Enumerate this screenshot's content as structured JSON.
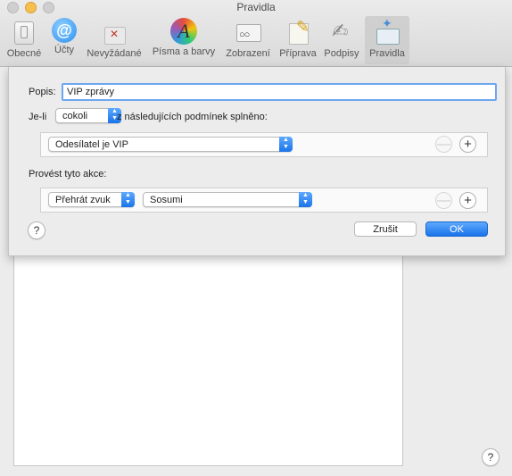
{
  "window": {
    "title": "Pravidla"
  },
  "toolbar": {
    "items": [
      {
        "label": "Obecné",
        "icon": "general-switch-icon"
      },
      {
        "label": "Účty",
        "icon": "at-sign-icon"
      },
      {
        "label": "Nevyžádané",
        "icon": "junk-trash-icon"
      },
      {
        "label": "Písma a barvy",
        "icon": "fonts-colors-icon"
      },
      {
        "label": "Zobrazení",
        "icon": "view-glasses-icon"
      },
      {
        "label": "Příprava",
        "icon": "compose-pencil-icon"
      },
      {
        "label": "Podpisy",
        "icon": "signature-icon"
      },
      {
        "label": "Pravidla",
        "icon": "rules-envelope-icon"
      }
    ],
    "active": "Pravidla"
  },
  "sheet": {
    "description_label": "Popis:",
    "description_value": "VIP zprávy",
    "if_label": "Je-li",
    "if_select": "cokoli",
    "if_suffix": "z následujících podmínek splněno:",
    "condition_select": "Odesílatel je VIP",
    "actions_label": "Provést tyto akce:",
    "action_select": "Přehrát zvuk",
    "sound_select": "Sosumi",
    "remove_symbol": "—",
    "add_symbol": "+",
    "help_symbol": "?",
    "cancel_label": "Zrušit",
    "ok_label": "OK"
  },
  "main": {
    "help_symbol": "?"
  },
  "colors": {
    "accent": "#1a73e8",
    "focus": "#6ea7f0"
  }
}
